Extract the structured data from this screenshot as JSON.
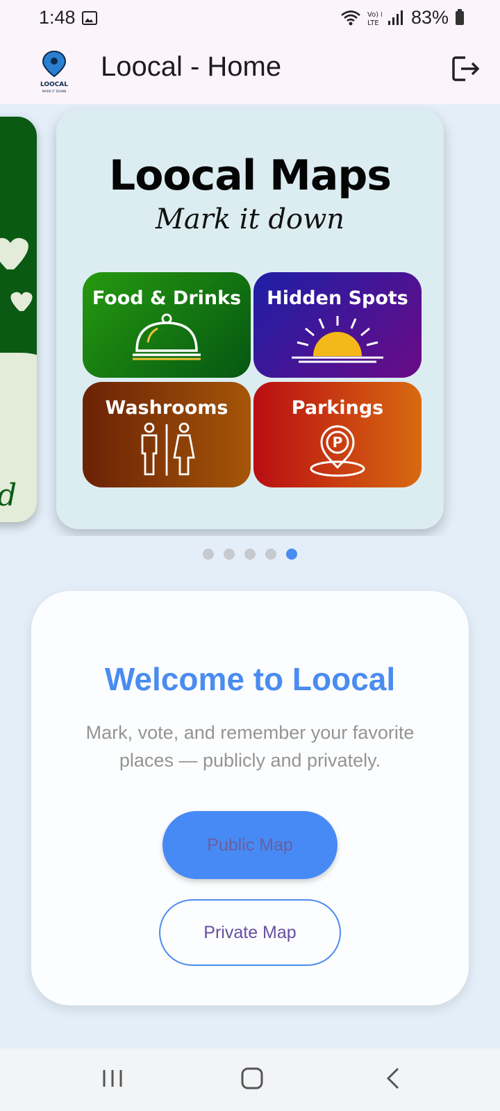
{
  "status_bar": {
    "time": "1:48",
    "battery": "83%",
    "lte_label": "Vo) LTE",
    "icons": [
      "image-icon",
      "wifi-icon",
      "volte-icon",
      "signal-icon",
      "battery-icon"
    ]
  },
  "app_bar": {
    "title": "Loocal - Home",
    "logo_text": "LOOCAL",
    "logo_tagline": "MARK IT DOWN",
    "logout_icon": "logout-icon"
  },
  "carousel": {
    "prev_card_text": "d",
    "main_card": {
      "title": "Loocal Maps",
      "subtitle": "Mark it down",
      "tiles": [
        {
          "label": "Food & Drinks",
          "icon": "cloche-icon"
        },
        {
          "label": "Hidden Spots",
          "icon": "sunrise-icon"
        },
        {
          "label": "Washrooms",
          "icon": "restroom-icon"
        },
        {
          "label": "Parkings",
          "icon": "parking-pin-icon"
        }
      ]
    },
    "dot_count": 5,
    "active_dot": 5
  },
  "welcome": {
    "title": "Welcome to Loocal",
    "text": "Mark, vote, and remember your favorite places — publicly and privately.",
    "public_button": "Public Map",
    "private_button": "Private Map"
  },
  "nav_bar": {
    "icons": [
      "recents-icon",
      "home-icon",
      "back-icon"
    ]
  },
  "colors": {
    "accent": "#4a8cf0",
    "background": "#e3eef8",
    "app_bar": "#fcf4fb"
  }
}
